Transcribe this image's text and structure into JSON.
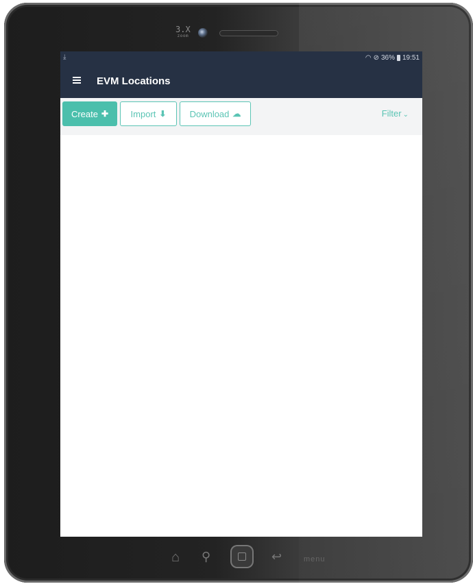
{
  "device": {
    "zoom_label": "3.X",
    "zoom_sub": "zoom",
    "nav_menu_label": "menu"
  },
  "statusbar": {
    "download_icon": "download-icon",
    "battery_text": "36%",
    "time": "19:51",
    "icons": [
      "wifi-icon",
      "do-not-disturb-icon",
      "battery-icon"
    ]
  },
  "appbar": {
    "title": "EVM Locations",
    "menu_icon": "hamburger-icon",
    "background": "#263144"
  },
  "toolbar": {
    "create_label": "Create",
    "create_icon": "plus-icon",
    "import_label": "Import",
    "import_icon": "download-tray-icon",
    "download_label": "Download",
    "download_icon": "cloud-download-icon",
    "filter_label": "Filter",
    "filter_icon": "chevron-down-icon",
    "accent_color": "#4bbfac"
  }
}
